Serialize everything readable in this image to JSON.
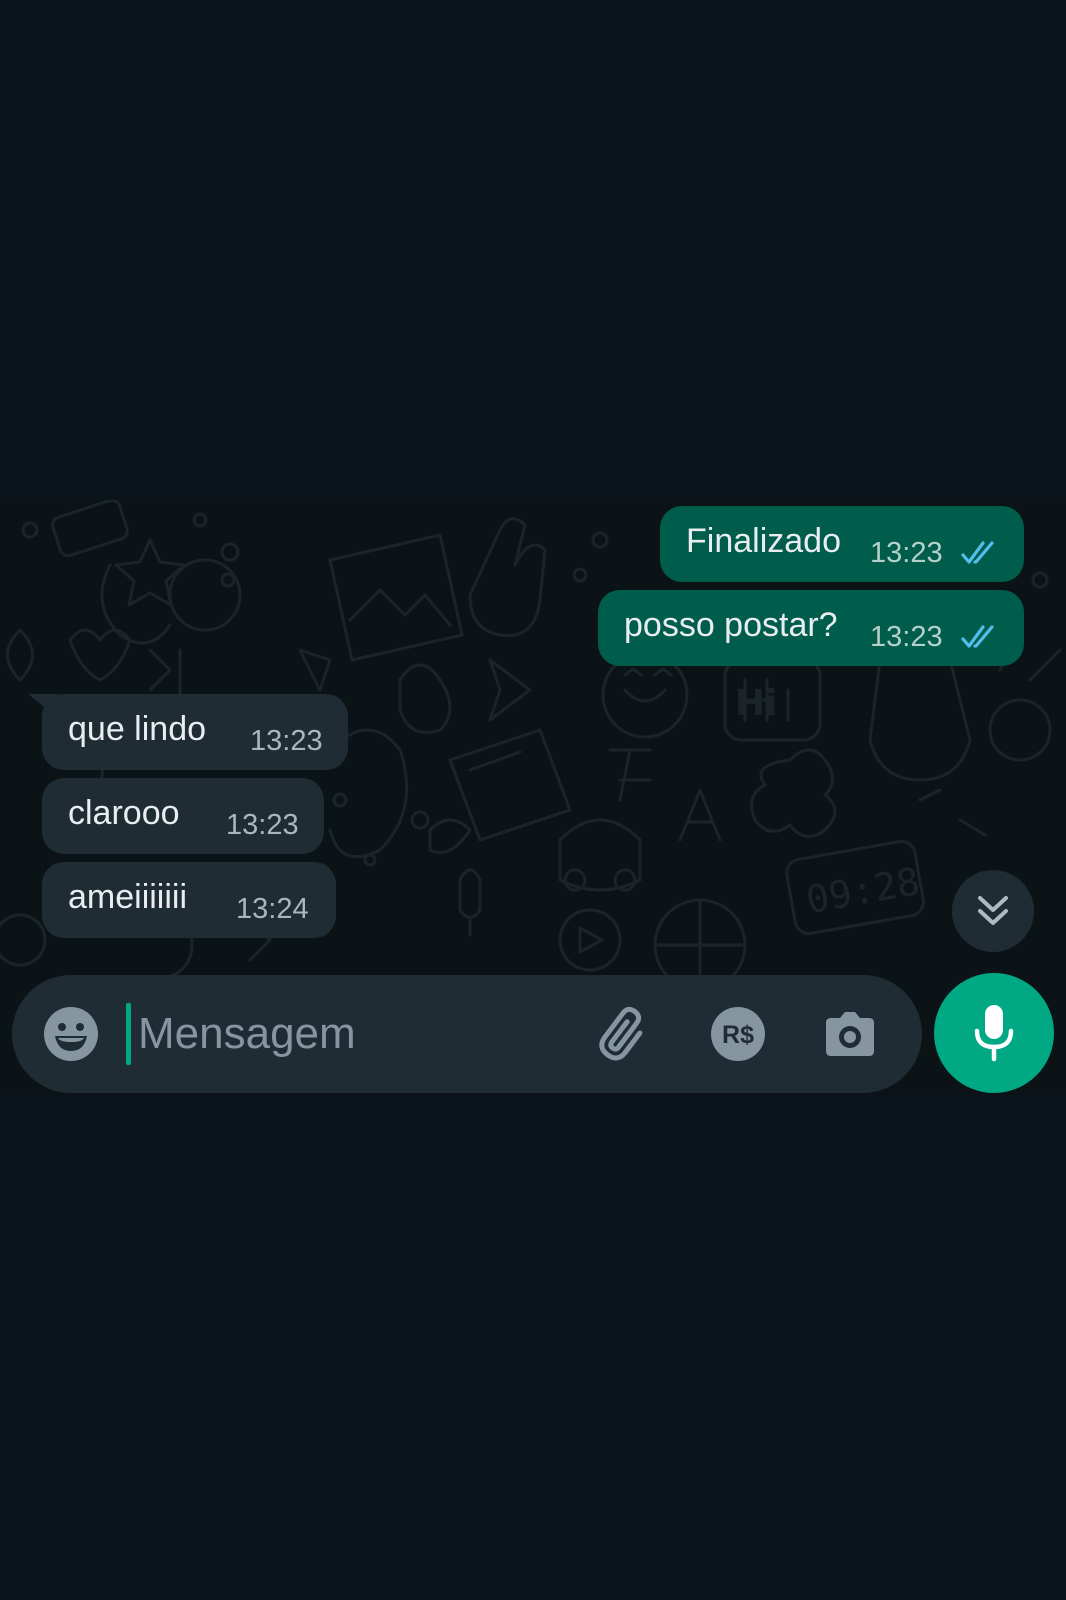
{
  "chat": {
    "messages": [
      {
        "direction": "outgoing",
        "text": "Finalizado",
        "time": "13:23",
        "status": "read"
      },
      {
        "direction": "outgoing",
        "text": "posso postar?",
        "time": "13:23",
        "status": "read"
      },
      {
        "direction": "incoming",
        "text": "que lindo",
        "time": "13:23"
      },
      {
        "direction": "incoming",
        "text": "clarooo",
        "time": "13:23"
      },
      {
        "direction": "incoming",
        "text": "ameiiiiiii",
        "time": "13:24"
      }
    ],
    "wallpaper_clock_text": "09:28",
    "wallpaper_hi_text": "Hi"
  },
  "composer": {
    "placeholder": "Mensagem",
    "value": "",
    "payment_label": "R$",
    "icons": [
      "emoji-icon",
      "paperclip-icon",
      "payment-icon",
      "camera-icon",
      "microphone-icon"
    ]
  },
  "colors": {
    "background": "#0b141a",
    "outgoing_bubble": "#005c4b",
    "incoming_bubble": "#1f2c34",
    "accent": "#00a884",
    "read_ticks": "#53bdeb"
  }
}
